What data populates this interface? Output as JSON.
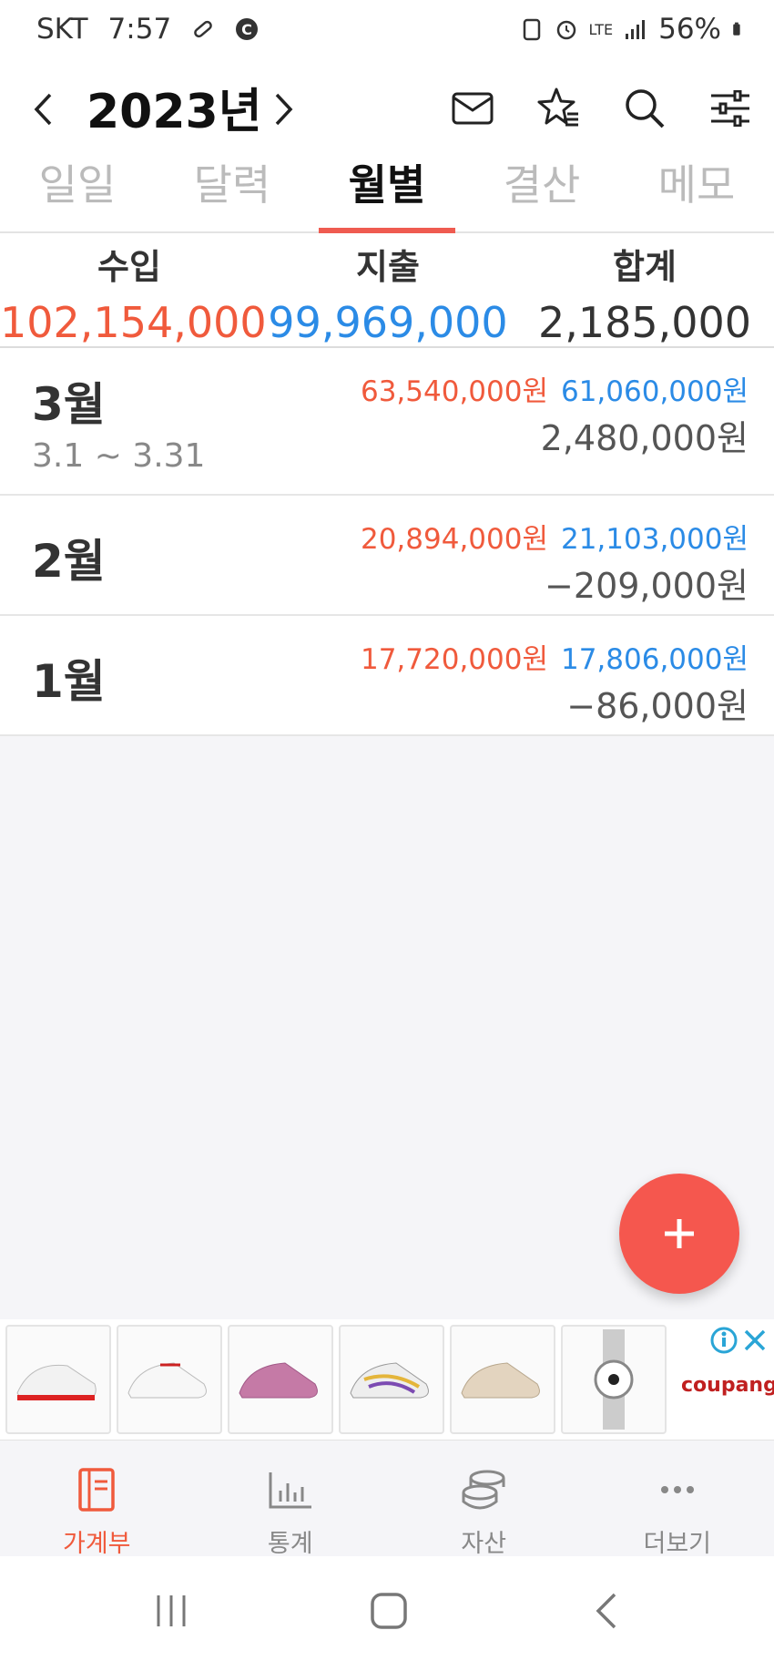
{
  "status_bar": {
    "carrier": "SKT",
    "time": "7:57",
    "network": "LTE",
    "battery": "56%"
  },
  "header": {
    "year": "2023년"
  },
  "tabs": [
    {
      "label": "일일",
      "active": false
    },
    {
      "label": "달력",
      "active": false
    },
    {
      "label": "월별",
      "active": true
    },
    {
      "label": "결산",
      "active": false
    },
    {
      "label": "메모",
      "active": false
    }
  ],
  "summary": {
    "income_label": "수입",
    "income": "102,154,000",
    "expense_label": "지출",
    "expense": "99,969,000",
    "total_label": "합계",
    "total": "2,185,000"
  },
  "months": [
    {
      "month": "3월",
      "range": "3.1 ~ 3.31",
      "income": "63,540,000원",
      "expense": "61,060,000원",
      "total": "2,480,000원"
    },
    {
      "month": "2월",
      "income": "20,894,000원",
      "expense": "21,103,000원",
      "total": "−209,000원"
    },
    {
      "month": "1월",
      "income": "17,720,000원",
      "expense": "17,806,000원",
      "total": "−86,000원"
    }
  ],
  "ad": {
    "brand": "coupang"
  },
  "bottom_nav": [
    {
      "label": "가계부",
      "icon": "book-icon",
      "active": true
    },
    {
      "label": "통계",
      "icon": "bar-chart-icon",
      "active": false
    },
    {
      "label": "자산",
      "icon": "coins-icon",
      "active": false
    },
    {
      "label": "더보기",
      "icon": "more-icon",
      "active": false
    }
  ],
  "colors": {
    "accent": "#f5574e",
    "income": "#f05a3c",
    "expense": "#2b8be6"
  }
}
